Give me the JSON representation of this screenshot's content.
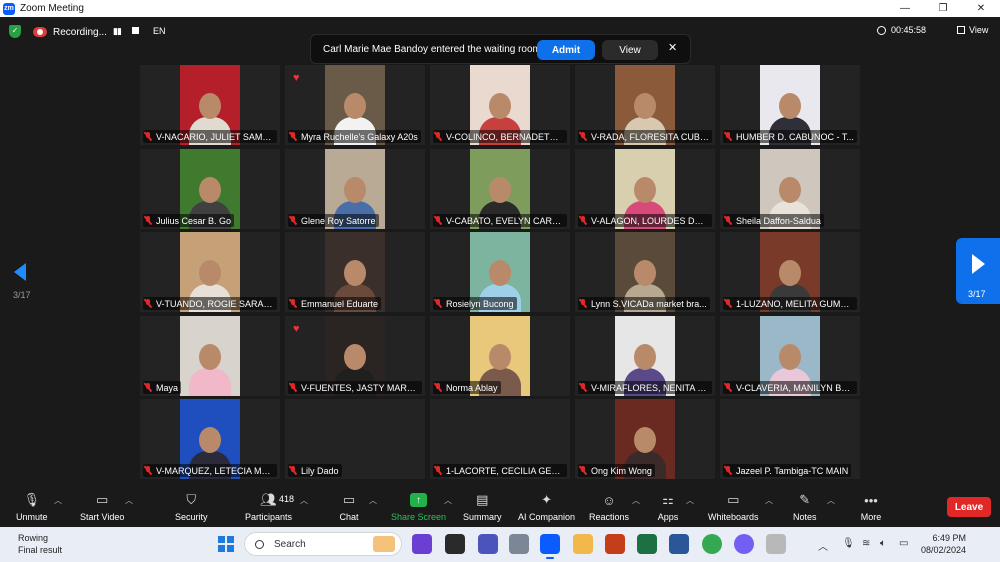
{
  "window": {
    "title": "Zoom Meeting",
    "app_icon": "zm"
  },
  "topbar": {
    "recording_label": "Recording...",
    "language": "EN",
    "timer": "00:45:58",
    "view_label": "View"
  },
  "notification": {
    "message": "Carl Marie Mae Bandoy entered the waiting room",
    "admit_label": "Admit",
    "view_label": "View"
  },
  "gallery": {
    "page_indicator_left": "3/17",
    "page_indicator_right": "3/17",
    "tiles": [
      {
        "name": "V-NACARIO, JULIET SAMA...",
        "bg": "#b51f2a",
        "shirt": "#e0dad0",
        "heart": false
      },
      {
        "name": "Myra Ruchelle's Galaxy A20s",
        "bg": "#6a5a48",
        "shirt": "#f2f2f2",
        "heart": true
      },
      {
        "name": "V-COLINCO, BERNADETH ...",
        "bg": "#e9d9cf",
        "shirt": "#c7403e",
        "heart": false
      },
      {
        "name": "V-RADA, FLORESITA CUBILO",
        "bg": "#8a5a3a",
        "shirt": "#d8c8b0",
        "heart": false
      },
      {
        "name": "HUMBER D. CABUNOC - T...",
        "bg": "#e8e8ee",
        "shirt": "#2f2f3a",
        "heart": false
      },
      {
        "name": "Julius Cesar B. Go",
        "bg": "#3f7a2e",
        "shirt": "#404040",
        "heart": false
      },
      {
        "name": "Glene Roy Satorre",
        "bg": "#b9aa95",
        "shirt": "#4a6fa8",
        "heart": false
      },
      {
        "name": "V-CABATO, EVELYN CARPIO",
        "bg": "#7e9c5c",
        "shirt": "#2a2a2a",
        "heart": false
      },
      {
        "name": "V-ALAGON, LOURDES DUA...",
        "bg": "#d8cfae",
        "shirt": "#d94a7a",
        "heart": false
      },
      {
        "name": "Sheila Daffon-Saldua",
        "bg": "#cfc7bd",
        "shirt": "#e8e2d8",
        "heart": false
      },
      {
        "name": "V-TUANDO, ROGIE SARAO...",
        "bg": "#c6a077",
        "shirt": "#e6e0d6",
        "heart": false
      },
      {
        "name": "Emmanuel Eduarte",
        "bg": "#3a2f2a",
        "shirt": "#6a4a3a",
        "heart": false
      },
      {
        "name": "Rosielyn Bucong",
        "bg": "#7db4a0",
        "shirt": "#9fd0ea",
        "heart": false
      },
      {
        "name": "Lynn S.VICADa   market bra...",
        "bg": "#5a4a3a",
        "shirt": "#b8a890",
        "heart": false
      },
      {
        "name": "1-LUZANO, MELITA GUMELA",
        "bg": "#7a3a2a",
        "shirt": "#3a3a3a",
        "heart": false
      },
      {
        "name": "Maya",
        "bg": "#d9d3ce",
        "shirt": "#f0b8c8",
        "heart": false
      },
      {
        "name": "V-FUENTES, JASTY MART L...",
        "bg": "#2a2522",
        "shirt": "#1f1f1f",
        "heart": true
      },
      {
        "name": "Norma Ablay",
        "bg": "#e8c87a",
        "shirt": "#7a5a4a",
        "heart": false
      },
      {
        "name": "V-MIRAFLORES, NENITA PE...",
        "bg": "#e6e6e6",
        "shirt": "#5a4a8a",
        "heart": false
      },
      {
        "name": "V-CLAVERIA, MANILYN BER...",
        "bg": "#9ab8c8",
        "shirt": "#e8c8d8",
        "heart": false
      },
      {
        "name": "V-MARQUEZ, LETECIA MAP...",
        "bg": "#1f4fbf",
        "shirt": "#2a2a3a",
        "heart": false
      },
      {
        "name": "Lily Dado",
        "bg": "",
        "shirt": "",
        "heart": false
      },
      {
        "name": "1-LACORTE, CECILIA GENTI...",
        "bg": "",
        "shirt": "",
        "heart": false
      },
      {
        "name": "Ong Kim Wong",
        "bg": "#6a2a22",
        "shirt": "#3a2a2a",
        "heart": false
      },
      {
        "name": "Jazeel P. Tambiga-TC MAIN",
        "bg": "",
        "shirt": "",
        "heart": false
      }
    ]
  },
  "toolbar": {
    "unmute": "Unmute",
    "start_video": "Start Video",
    "security": "Security",
    "participants": "Participants",
    "participants_count": "418",
    "chat": "Chat",
    "share_screen": "Share Screen",
    "summary": "Summary",
    "ai_companion": "AI Companion",
    "reactions": "Reactions",
    "apps": "Apps",
    "whiteboards": "Whiteboards",
    "notes": "Notes",
    "more": "More",
    "leave": "Leave"
  },
  "taskbar": {
    "weather_line1": "Rowing",
    "weather_line2": "Final result",
    "search_placeholder": "Search",
    "time": "6:49 PM",
    "date": "08/02/2024"
  },
  "colors": {
    "accent": "#0e71eb",
    "leave": "#e02828",
    "mute": "#e02828",
    "share": "#23b14a"
  }
}
